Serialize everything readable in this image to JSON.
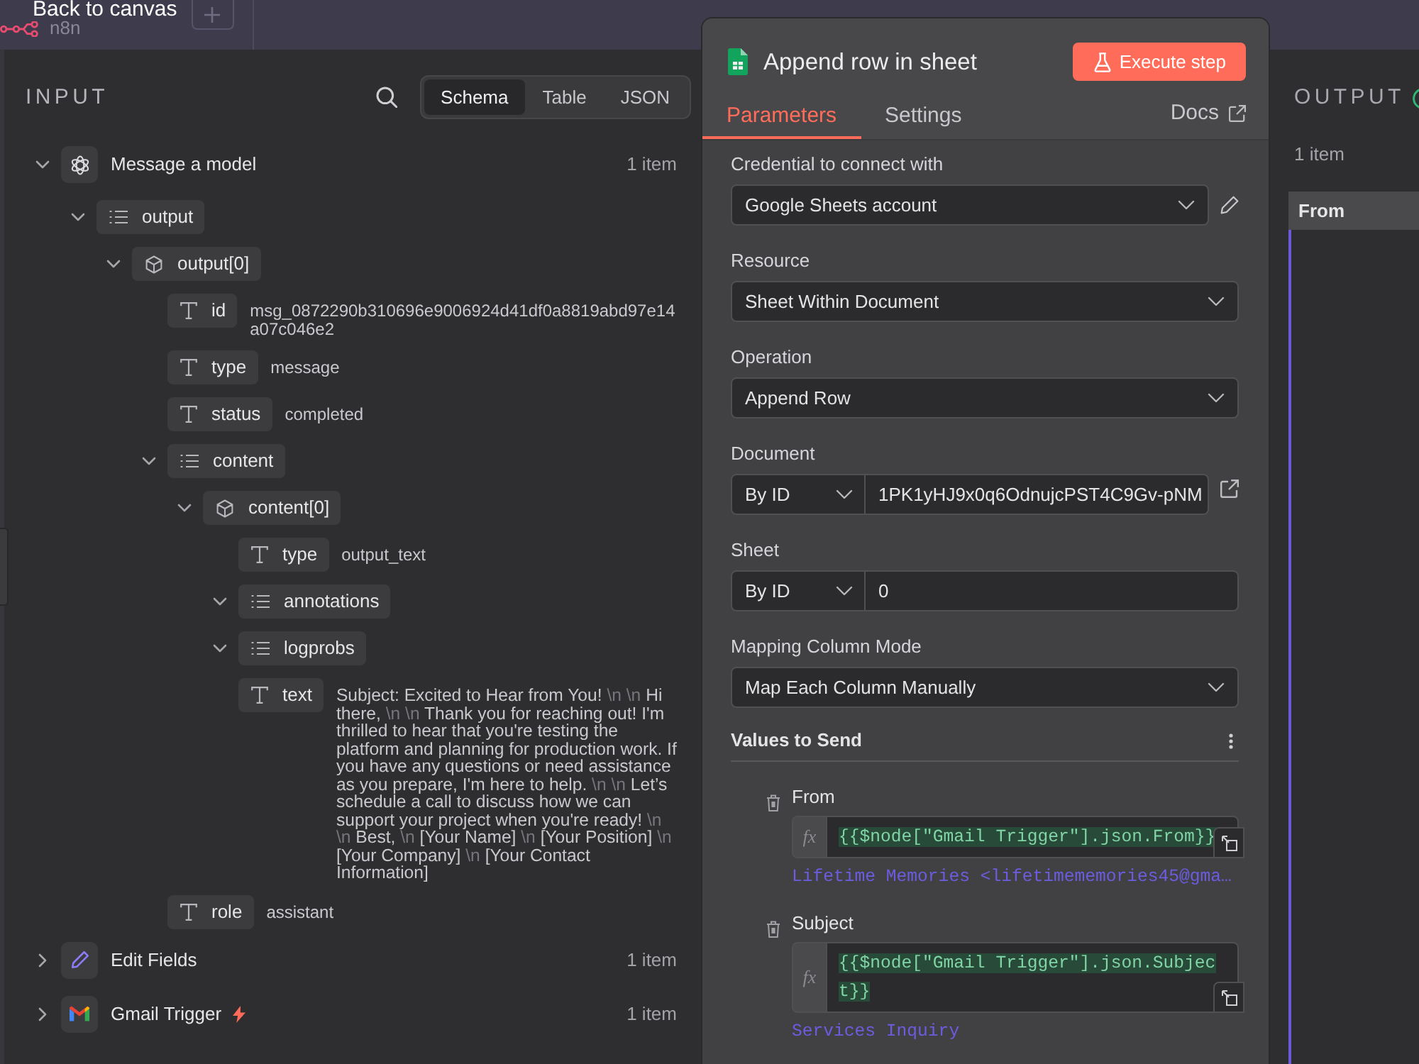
{
  "top_bar": {
    "logo_text": "n8n",
    "back_label": "Back to canvas"
  },
  "input_panel": {
    "title": "INPUT",
    "view_tabs": [
      {
        "label": "Schema",
        "selected": true
      },
      {
        "label": "Table",
        "selected": false
      },
      {
        "label": "JSON",
        "selected": false
      }
    ],
    "nodes": [
      {
        "kind": "model",
        "name": "Message a model",
        "count": "1 item",
        "expanded": true,
        "children": [
          {
            "kind": "array",
            "key": "output",
            "expanded": true,
            "children": [
              {
                "kind": "object",
                "key": "output[0]",
                "expanded": true,
                "children": [
                  {
                    "kind": "string",
                    "key": "id",
                    "value": "msg_0872290b310696e9006924d41df0a8819abd97e14a07c046e2"
                  },
                  {
                    "kind": "string",
                    "key": "type",
                    "value": "message"
                  },
                  {
                    "kind": "string",
                    "key": "status",
                    "value": "completed"
                  },
                  {
                    "kind": "array",
                    "key": "content",
                    "expanded": true,
                    "children": [
                      {
                        "kind": "object",
                        "key": "content[0]",
                        "expanded": true,
                        "children": [
                          {
                            "kind": "string",
                            "key": "type",
                            "value": "output_text"
                          },
                          {
                            "kind": "array",
                            "key": "annotations",
                            "expanded": true
                          },
                          {
                            "kind": "array",
                            "key": "logprobs",
                            "expanded": true
                          },
                          {
                            "kind": "string",
                            "key": "text",
                            "value_parts": [
                              {
                                "kind": "text",
                                "text": "Subject: Excited to Hear from You!"
                              },
                              {
                                "kind": "escape",
                                "text": "\\n"
                              },
                              {
                                "kind": "escape",
                                "text": "\\n"
                              },
                              {
                                "kind": "text",
                                "text": "Hi there,"
                              },
                              {
                                "kind": "escape",
                                "text": "\\n"
                              },
                              {
                                "kind": "escape",
                                "text": "\\n"
                              },
                              {
                                "kind": "text",
                                "text": "Thank you for reaching out! I'm thrilled to hear that you're testing the platform and planning for production work. If you have any questions or need assistance as you prepare, I'm here to help."
                              },
                              {
                                "kind": "escape",
                                "text": "\\n"
                              },
                              {
                                "kind": "escape",
                                "text": "\\n"
                              },
                              {
                                "kind": "text",
                                "text": "Let’s schedule a call to discuss how we can support your project when you're ready!"
                              },
                              {
                                "kind": "escape",
                                "text": "\\n"
                              },
                              {
                                "kind": "escape",
                                "text": "\\n"
                              },
                              {
                                "kind": "text",
                                "text": "Best,"
                              },
                              {
                                "kind": "escape",
                                "text": "\\n"
                              },
                              {
                                "kind": "text",
                                "text": "[Your Name]"
                              },
                              {
                                "kind": "escape",
                                "text": "\\n"
                              },
                              {
                                "kind": "text",
                                "text": "[Your Position]"
                              },
                              {
                                "kind": "escape",
                                "text": "\\n"
                              },
                              {
                                "kind": "text",
                                "text": "[Your Company]"
                              },
                              {
                                "kind": "escape",
                                "text": "\\n"
                              },
                              {
                                "kind": "text",
                                "text": "[Your Contact Information]"
                              }
                            ]
                          }
                        ]
                      }
                    ]
                  },
                  {
                    "kind": "string",
                    "key": "role",
                    "value": "assistant"
                  }
                ]
              }
            ]
          }
        ]
      },
      {
        "kind": "edit",
        "name": "Edit Fields",
        "count": "1 item",
        "expanded": false
      },
      {
        "kind": "trigger",
        "name": "Gmail Trigger",
        "count": "1 item",
        "expanded": false
      }
    ]
  },
  "node_panel": {
    "title": "Append row in sheet",
    "execute_label": "Execute step",
    "tabs": [
      {
        "label": "Parameters",
        "selected": true
      },
      {
        "label": "Settings",
        "selected": false
      }
    ],
    "docs_label": "Docs",
    "fields": [
      {
        "kind": "credential",
        "label": "Credential to connect with",
        "value": "Google Sheets account"
      },
      {
        "kind": "select",
        "label": "Resource",
        "value": "Sheet Within Document"
      },
      {
        "kind": "select",
        "label": "Operation",
        "value": "Append Row"
      },
      {
        "kind": "locator",
        "label": "Document",
        "mode": "By ID",
        "value": "1PK1yHJ9x0q6OdnujcPST4C9Gv-pNM",
        "external_link": true
      },
      {
        "kind": "locator",
        "label": "Sheet",
        "mode": "By ID",
        "value": "0",
        "external_link": false
      },
      {
        "kind": "select",
        "label": "Mapping Column Mode",
        "value": "Map Each Column Manually"
      }
    ],
    "values_to_send": {
      "title": "Values to Send",
      "columns": [
        {
          "name": "From",
          "badge": "fx",
          "expression": "{{$node[\"Gmail Trigger\"].json.From}}",
          "result": "Lifetime Memories <lifetimememories45@gma…"
        },
        {
          "name": "Subject",
          "badge": "fx",
          "expression": "{{$node[\"Gmail Trigger\"].json.Subject}}",
          "result": "Services Inquiry"
        }
      ]
    }
  },
  "output_panel": {
    "title": "OUTPUT",
    "count": "1 item",
    "table": {
      "columns": [
        "From"
      ]
    }
  }
}
